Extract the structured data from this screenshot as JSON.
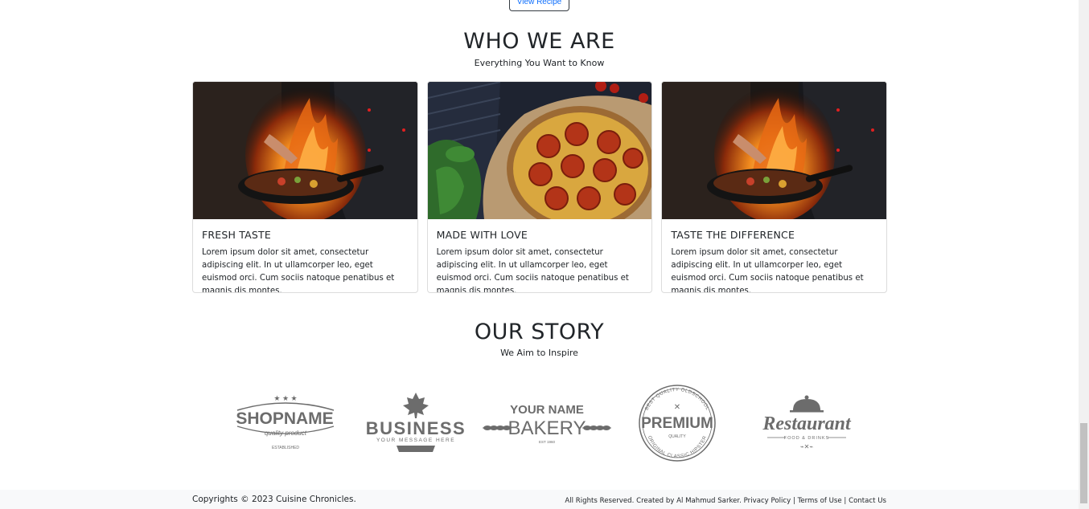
{
  "top_button": {
    "label": "View Recipe"
  },
  "who_we_are": {
    "title": "WHO WE ARE",
    "subtitle": "Everything You Want to Know",
    "cards": [
      {
        "title": "FRESH TASTE",
        "text": "Lorem ipsum dolor sit amet, consectetur adipiscing elit. In ut ullamcorper leo, eget euismod orci. Cum sociis natoque penatibus et magnis dis montes.",
        "image": "chef-flaming-pan"
      },
      {
        "title": "MADE WITH LOVE",
        "text": "Lorem ipsum dolor sit amet, consectetur adipiscing elit. In ut ullamcorper leo, eget euismod orci. Cum sociis natoque penatibus et magnis dis montes.",
        "image": "tomato-pizza"
      },
      {
        "title": "TASTE THE DIFFERENCE",
        "text": "Lorem ipsum dolor sit amet, consectetur adipiscing elit. In ut ullamcorper leo, eget euismod orci. Cum sociis natoque penatibus et magnis dis montes.",
        "image": "chef-flaming-pan"
      }
    ]
  },
  "our_story": {
    "title": "OUR STORY",
    "subtitle": "We Aim to Inspire",
    "logos": [
      {
        "name": "SHOPNAME",
        "sub": "quality product",
        "extra": "ESTABLISHED"
      },
      {
        "name": "BUSINESS",
        "sub": "YOUR MESSAGE HERE"
      },
      {
        "name": "YOUR NAME",
        "sub": "BAKERY",
        "extra": "EST 1960"
      },
      {
        "name": "PREMIUM",
        "sub": "QUALITY",
        "ring": "BEST QUALITY OLDSCHOOL",
        "ring2": "ORIGINAL CLASSIC HIPSTER"
      },
      {
        "name": "Restaurant",
        "sub": "FOOD & DRINKS"
      }
    ]
  },
  "footer": {
    "copyright": "Copyrights © 2023 Cuisine Chronicles.",
    "rights": "All Rights Reserved. Created by Al Mahmud Sarker.",
    "links": [
      "Privacy Policy",
      "Terms of Use",
      "Contact Us"
    ]
  },
  "colors": {
    "text": "#212529",
    "logo_gray": "#6c6c6c",
    "footer_bg": "#f8f9fa"
  }
}
